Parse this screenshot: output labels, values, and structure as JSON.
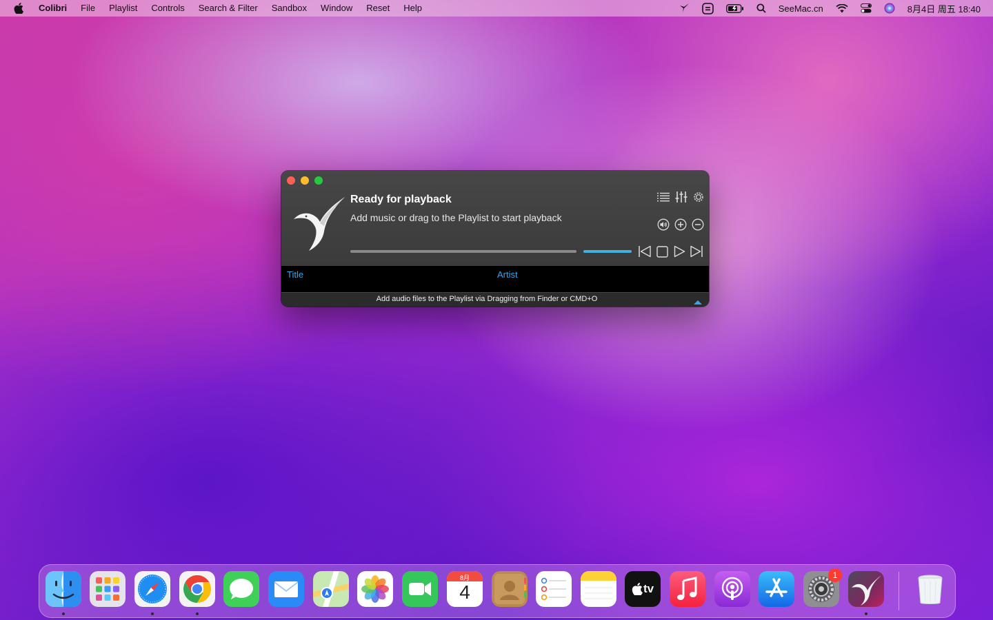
{
  "menubar": {
    "app_name": "Colibri",
    "items": [
      "File",
      "Playlist",
      "Controls",
      "Search & Filter",
      "Sandbox",
      "Window",
      "Reset",
      "Help"
    ],
    "site": "SeeMac.cn",
    "datetime": "8月4日 周五  18:40"
  },
  "player": {
    "status_title": "Ready for playback",
    "status_subtitle": "Add music or drag to the Playlist to start playback",
    "columns": {
      "title": "Title",
      "artist": "Artist"
    },
    "footer_hint": "Add audio files to the Playlist via Dragging from Finder or CMD+O",
    "progress": 0,
    "volume": 1.0
  },
  "dock": {
    "calendar_month": "8月",
    "calendar_day": "4",
    "tv_label": "tv",
    "settings_badge": "1"
  },
  "colors": {
    "accent_blue": "#3aa6e8",
    "volume_bar": "#44b0e0",
    "close": "#fe5f57",
    "minimize": "#febc2e",
    "maximize": "#28c840"
  }
}
